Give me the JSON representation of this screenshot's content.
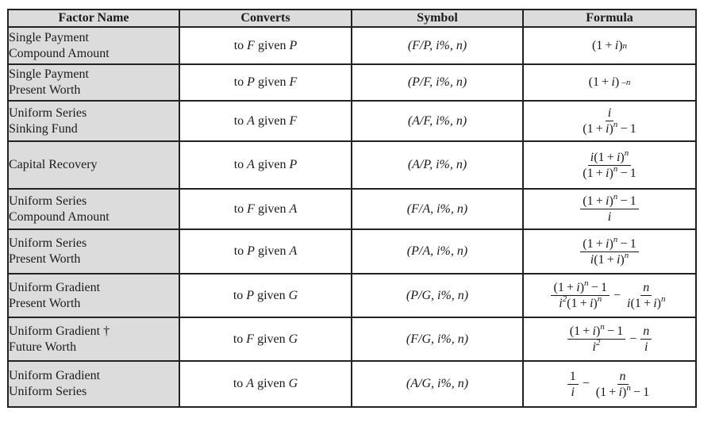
{
  "table": {
    "headers": [
      "Factor Name",
      "Converts",
      "Symbol",
      "Formula"
    ],
    "rows": [
      {
        "name": [
          "Single Payment",
          "Compound Amount"
        ],
        "converts": {
          "prefix": "to",
          "target": "F",
          "middle": "given",
          "source": "P"
        },
        "symbol": "(F/P, i%, n)",
        "formula": {
          "type": "simple",
          "text": "(1 + i)",
          "exp": "n"
        }
      },
      {
        "name": [
          "Single Payment",
          "Present Worth"
        ],
        "converts": {
          "prefix": "to",
          "target": "P",
          "middle": "given",
          "source": "F"
        },
        "symbol": "(P/F, i%, n)",
        "formula": {
          "type": "simple",
          "text": "(1 + i) ",
          "exp": "–n"
        }
      },
      {
        "name": [
          "Uniform Series",
          "Sinking Fund"
        ],
        "converts": {
          "prefix": "to",
          "target": "A",
          "middle": "given",
          "source": "F"
        },
        "symbol": "(A/F, i%, n)",
        "formula": {
          "type": "fraction",
          "num": "i",
          "den": "(1 + i)^n − 1"
        }
      },
      {
        "name": [
          "Capital Recovery"
        ],
        "converts": {
          "prefix": "to",
          "target": "A",
          "middle": "given",
          "source": "P"
        },
        "symbol": "(A/P, i%, n)",
        "formula": {
          "type": "fraction",
          "num": "i(1 + i)^n",
          "den": "(1 + i)^n − 1"
        }
      },
      {
        "name": [
          "Uniform Series",
          "Compound Amount"
        ],
        "converts": {
          "prefix": "to",
          "target": "F",
          "middle": "given",
          "source": "A"
        },
        "symbol": "(F/A, i%, n)",
        "formula": {
          "type": "fraction",
          "num": "(1 + i)^n − 1",
          "den": "i"
        }
      },
      {
        "name": [
          "Uniform Series",
          "Present Worth"
        ],
        "converts": {
          "prefix": "to",
          "target": "P",
          "middle": "given",
          "source": "A"
        },
        "symbol": "(P/A, i%, n)",
        "formula": {
          "type": "fraction",
          "num": "(1 + i)^n − 1",
          "den": "i(1 + i)^n"
        }
      },
      {
        "name": [
          "Uniform Gradient",
          "Present Worth"
        ],
        "converts": {
          "prefix": "to",
          "target": "P",
          "middle": "given",
          "source": "G"
        },
        "symbol": "(P/G, i%, n)",
        "formula": {
          "type": "difference",
          "left": {
            "num": "(1 + i)^n − 1",
            "den": "i^2(1 + i)^n"
          },
          "op": "−",
          "right": {
            "num": "n",
            "den": "i(1 + i)^n"
          }
        }
      },
      {
        "name": [
          "Uniform Gradient †",
          "Future Worth"
        ],
        "converts": {
          "prefix": "to",
          "target": "F",
          "middle": "given",
          "source": "G"
        },
        "symbol": "(F/G, i%, n)",
        "formula": {
          "type": "difference",
          "left": {
            "num": "(1 + i)^n − 1",
            "den": "i^2"
          },
          "op": "−",
          "right": {
            "num": "n",
            "den": "i"
          }
        }
      },
      {
        "name": [
          "Uniform Gradient",
          "Uniform Series"
        ],
        "converts": {
          "prefix": "to",
          "target": "A",
          "middle": "given",
          "source": "G"
        },
        "symbol": "(A/G, i%, n)",
        "formula": {
          "type": "difference",
          "left": {
            "num": "1",
            "den": "i"
          },
          "op": "−",
          "right": {
            "num": "n",
            "den": "(1 + i)^n − 1"
          }
        }
      }
    ]
  }
}
